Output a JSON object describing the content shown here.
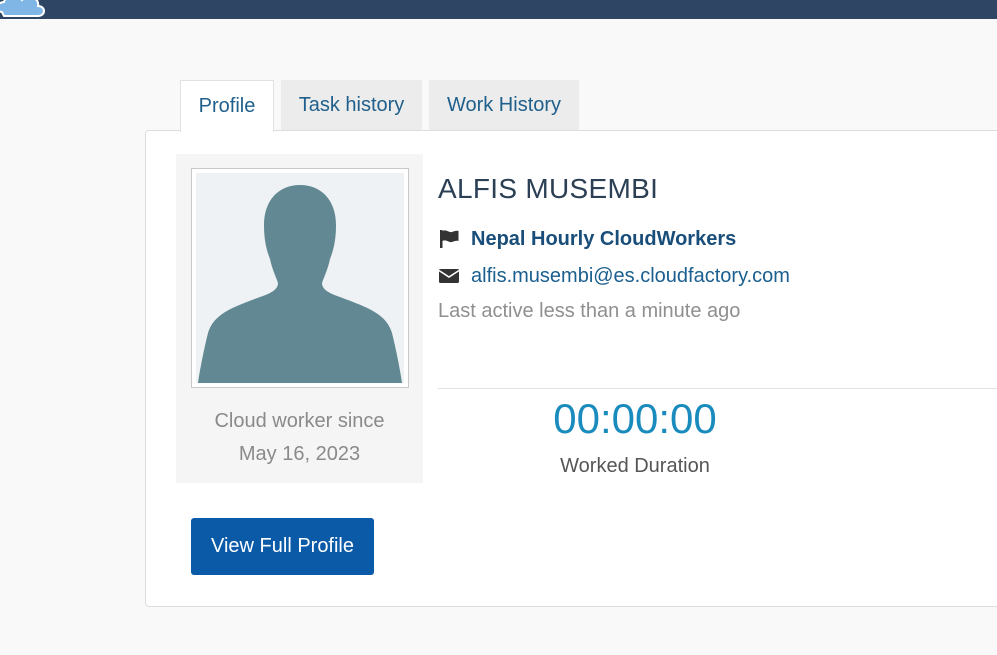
{
  "tabs": [
    {
      "label": "Profile",
      "active": true
    },
    {
      "label": "Task history",
      "active": false
    },
    {
      "label": "Work History",
      "active": false
    }
  ],
  "profile": {
    "name": "ALFIS MUSEMBI",
    "team": "Nepal Hourly CloudWorkers",
    "email": "alfis.musembi@es.cloudfactory.com",
    "last_active": "Last active less than a minute ago",
    "since_label": "Cloud worker since",
    "since_date": "May 16, 2023"
  },
  "stats": {
    "worked_duration": "00:00:00",
    "worked_duration_label": "Worked Duration"
  },
  "actions": {
    "view_full_profile": "View Full Profile"
  },
  "icons": {
    "team": "flag-icon",
    "email": "envelope-icon",
    "avatar": "person-silhouette-icon",
    "logo": "cloud-logo-icon"
  },
  "colors": {
    "topbar": "#2e4563",
    "primary_button": "#0a5aa8",
    "duration": "#1a8bbd",
    "link": "#1a5f8f",
    "avatar_silhouette": "#628993"
  }
}
